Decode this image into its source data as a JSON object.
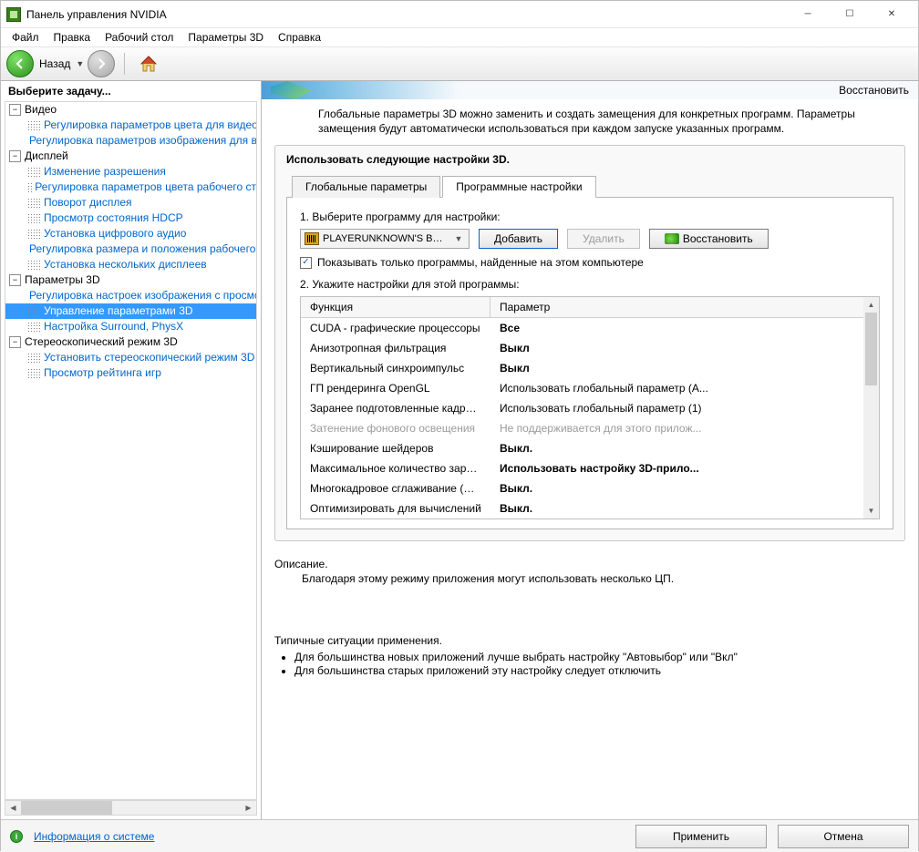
{
  "window": {
    "title": "Панель управления NVIDIA"
  },
  "menu": {
    "file": "Файл",
    "edit": "Правка",
    "desktop": "Рабочий стол",
    "params3d": "Параметры 3D",
    "help": "Справка"
  },
  "toolbar": {
    "back_label": "Назад"
  },
  "sidebar": {
    "header": "Выберите задачу...",
    "categories": [
      {
        "label": "Видео",
        "items": [
          "Регулировка параметров цвета для видео",
          "Регулировка параметров изображения для видео"
        ]
      },
      {
        "label": "Дисплей",
        "items": [
          "Изменение разрешения",
          "Регулировка параметров цвета рабочего стола",
          "Поворот дисплея",
          "Просмотр состояния HDCP",
          "Установка цифрового аудио",
          "Регулировка размера и положения рабочего стола",
          "Установка нескольких дисплеев"
        ]
      },
      {
        "label": "Параметры 3D",
        "items": [
          "Регулировка настроек изображения с просмотром",
          "Управление параметрами 3D",
          "Настройка Surround, PhysX"
        ]
      },
      {
        "label": "Стереоскопический режим 3D",
        "items": [
          "Установить стереоскопический режим 3D",
          "Просмотр рейтинга игр"
        ]
      }
    ],
    "selected": "Управление параметрами 3D"
  },
  "main": {
    "restore_link": "Восстановить",
    "intro": "Глобальные параметры 3D можно заменить и создать замещения для конкретных программ. Параметры замещения будут автоматически использоваться при каждом запуске указанных программ.",
    "group_title": "Использовать следующие настройки 3D.",
    "tabs": {
      "global": "Глобальные параметры",
      "program": "Программные настройки"
    },
    "step1": "1. Выберите программу для настройки:",
    "program_combo": "PLAYERUNKNOWN'S BATTLEGR...",
    "add_btn": "Добавить",
    "del_btn": "Удалить",
    "restore_btn": "Восстановить",
    "show_only_checkbox": "Показывать только программы, найденные на этом компьютере",
    "step2": "2. Укажите настройки для этой программы:",
    "table": {
      "h_func": "Функция",
      "h_param": "Параметр",
      "rows": [
        {
          "func": "CUDA - графические процессоры",
          "param": "Все",
          "bold": true
        },
        {
          "func": "Анизотропная фильтрация",
          "param": "Выкл",
          "bold": true
        },
        {
          "func": "Вертикальный синхроимпульс",
          "param": "Выкл",
          "bold": true
        },
        {
          "func": "ГП рендеринга OpenGL",
          "param": "Использовать глобальный параметр (А...",
          "bold": false
        },
        {
          "func": "Заранее подготовленные кадры ви...",
          "param": "Использовать глобальный параметр (1)",
          "bold": false
        },
        {
          "func": "Затенение фонового освещения",
          "param": "Не поддерживается для этого прилож...",
          "bold": false,
          "disabled": true
        },
        {
          "func": "Кэширование шейдеров",
          "param": "Выкл.",
          "bold": true
        },
        {
          "func": "Максимальное количество заранее ...",
          "param": "Использовать настройку 3D-прило...",
          "bold": true
        },
        {
          "func": "Многокадровое сглаживание (MFAA)",
          "param": "Выкл.",
          "bold": true
        },
        {
          "func": "Оптимизировать для вычислений",
          "param": "Выкл.",
          "bold": true
        }
      ]
    },
    "description": {
      "title": "Описание.",
      "body": "Благодаря этому режиму приложения могут использовать несколько ЦП."
    },
    "usage": {
      "title": "Типичные ситуации применения.",
      "items": [
        "Для большинства новых приложений лучше выбрать настройку \"Автовыбор\" или \"Вкл\"",
        "Для большинства старых приложений эту настройку следует отключить"
      ]
    }
  },
  "footer": {
    "sysinfo": "Информация о системе",
    "apply": "Применить",
    "cancel": "Отмена"
  }
}
